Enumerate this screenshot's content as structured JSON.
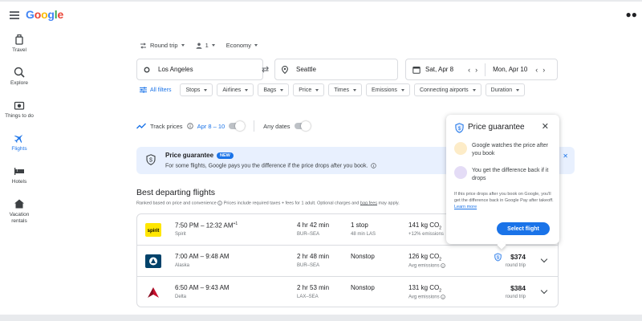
{
  "header": {
    "logo_letters": [
      "G",
      "o",
      "o",
      "g",
      "l",
      "e"
    ]
  },
  "nav": {
    "items": [
      {
        "label": "Travel",
        "icon": "suitcase-icon"
      },
      {
        "label": "Explore",
        "icon": "explore-icon"
      },
      {
        "label": "Things to do",
        "icon": "camera-icon"
      },
      {
        "label": "Flights",
        "icon": "airplane-icon"
      },
      {
        "label": "Hotels",
        "icon": "bed-icon"
      },
      {
        "label": "Vacation rentals",
        "icon": "house-icon"
      }
    ]
  },
  "search": {
    "trip_type": "Round trip",
    "passengers": "1",
    "cabin": "Economy",
    "from": "Los Angeles",
    "to": "Seattle",
    "depart_date": "Sat, Apr 8",
    "return_date": "Mon, Apr 10"
  },
  "filters": {
    "all_label": "All filters",
    "items": [
      "Stops",
      "Airlines",
      "Bags",
      "Price",
      "Times",
      "Emissions",
      "Connecting airports",
      "Duration"
    ]
  },
  "track": {
    "label": "Track prices",
    "dates": "Apr 8 – 10",
    "any_dates": "Any dates"
  },
  "guarantee_banner": {
    "title": "Price guarantee",
    "badge": "NEW",
    "description": "For some flights, Google pays you the difference if the price drops after you book."
  },
  "results": {
    "title": "Best departing flights",
    "subtitle_a": "Ranked based on price and convenience",
    "subtitle_b": "Prices include required taxes + fees for 1 adult. Optional charges and",
    "subtitle_link": "bag fees",
    "subtitle_c": "may apply.",
    "rows": [
      {
        "times": "7:50 PM – 12:32 AM",
        "day_offset": "+1",
        "airline": "Spirit",
        "duration": "4 hr 42 min",
        "route": "BUR–SEA",
        "stops": "1 stop",
        "stop_info": "48 min LAS",
        "emissions": "141 kg CO",
        "emissions_sub": "2",
        "emissions_note": "+12% emissions",
        "price": "",
        "price_type": ""
      },
      {
        "times": "7:00 AM – 9:48 AM",
        "day_offset": "",
        "airline": "Alaska",
        "duration": "2 hr 48 min",
        "route": "BUR–SEA",
        "stops": "Nonstop",
        "stop_info": "",
        "emissions": "126 kg CO",
        "emissions_sub": "2",
        "emissions_note": "Avg emissions",
        "price": "$374",
        "price_type": "round trip"
      },
      {
        "times": "6:50 AM – 9:43 AM",
        "day_offset": "",
        "airline": "Delta",
        "duration": "2 hr 53 min",
        "route": "LAX–SEA",
        "stops": "Nonstop",
        "stop_info": "",
        "emissions": "131 kg CO",
        "emissions_sub": "2",
        "emissions_note": "Avg emissions",
        "price": "$384",
        "price_type": "round trip"
      }
    ]
  },
  "popup": {
    "title": "Price guarantee",
    "item1": "Google watches the price after you book",
    "item2": "You get the difference back if it drops",
    "fine": "If this price drops after you book on Google, you'll get the difference back in Google Pay after takeoff.",
    "learn_more": "Learn more",
    "button": "Select flight"
  },
  "colors": {
    "accent": "#1a73e8",
    "banner_bg": "#e8f0fe",
    "spirit": "#ffe600",
    "alaska": "#01426a",
    "delta": "#c8102e"
  }
}
